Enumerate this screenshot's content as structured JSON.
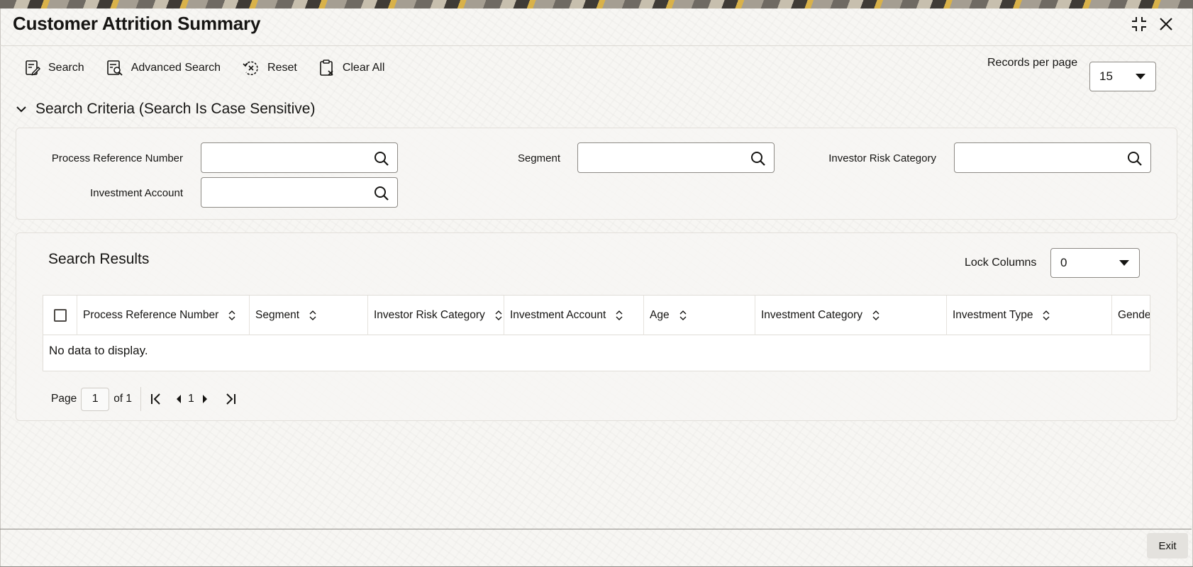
{
  "window": {
    "title": "Customer Attrition Summary",
    "minimize_icon": "collapse-icon",
    "close_icon": "close-icon"
  },
  "toolbar": {
    "search_label": "Search",
    "advanced_search_label": "Advanced Search",
    "reset_label": "Reset",
    "clear_all_label": "Clear All",
    "records_per_page_label": "Records per page",
    "records_per_page_value": "15"
  },
  "criteria": {
    "heading": "Search Criteria (Search Is Case Sensitive)",
    "fields": {
      "process_reference_number": {
        "label": "Process Reference Number",
        "value": ""
      },
      "segment": {
        "label": "Segment",
        "value": ""
      },
      "investor_risk_category": {
        "label": "Investor Risk Category",
        "value": ""
      },
      "investment_account": {
        "label": "Investment Account",
        "value": ""
      }
    }
  },
  "results": {
    "title": "Search Results",
    "lock_columns_label": "Lock Columns",
    "lock_columns_value": "0",
    "columns": [
      "Process Reference Number",
      "Segment",
      "Investor Risk Category",
      "Investment Account",
      "Age",
      "Investment Category",
      "Investment Type",
      "Gende"
    ],
    "empty_message": "No data to display."
  },
  "pager": {
    "page_label": "Page",
    "current_page": "1",
    "of_label": "of 1",
    "page_number": "1"
  },
  "footer": {
    "exit_label": "Exit"
  },
  "colors": {
    "text": "#161513",
    "border": "#8d8a85",
    "background": "#f7f6f3"
  }
}
